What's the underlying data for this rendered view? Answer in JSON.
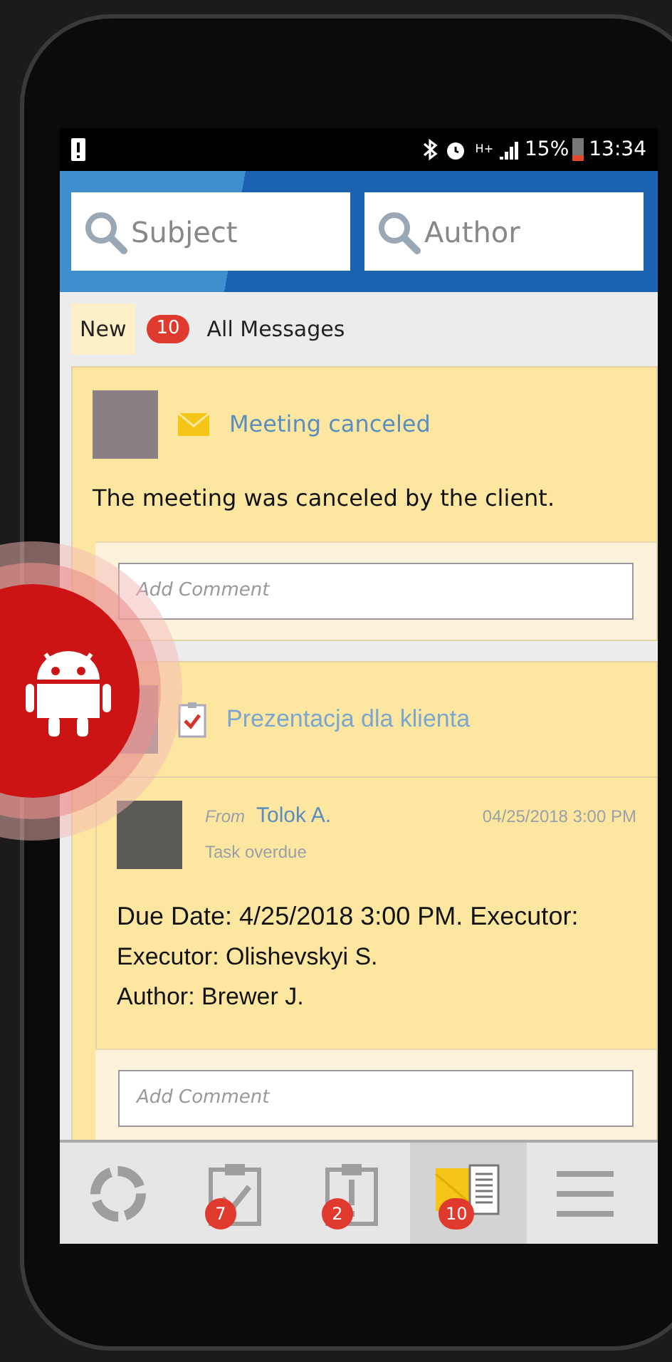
{
  "status_bar": {
    "network": "H+",
    "battery": "15%",
    "time": "13:34"
  },
  "search": [
    {
      "placeholder": "Subject"
    },
    {
      "placeholder": "Author"
    }
  ],
  "filter": {
    "new_label": "New",
    "new_count": "10",
    "all_label": "All Messages"
  },
  "cards": [
    {
      "kind": "message",
      "title": "Meeting canceled",
      "body": "The meeting was canceled by the client.",
      "comment_placeholder": "Add Comment"
    },
    {
      "kind": "task",
      "title": "Prezentacja dla klienta",
      "reply": {
        "from_label": "From",
        "author": "Tolok A.",
        "date": "04/25/2018 3:00 PM",
        "status": "Task overdue",
        "lines": [
          "Due Date: 4/25/2018 3:00 PM. Executor:",
          "Executor: Olishevskyi S.",
          "Author: Brewer J."
        ]
      },
      "comment_placeholder": "Add Comment"
    }
  ],
  "nav": [
    {
      "kind": "sync",
      "selected": false
    },
    {
      "kind": "tasks",
      "badge": "7",
      "selected": false
    },
    {
      "kind": "alerts",
      "badge": "2",
      "selected": false
    },
    {
      "kind": "messages",
      "badge": "10",
      "selected": true
    },
    {
      "kind": "menu",
      "selected": false
    }
  ]
}
